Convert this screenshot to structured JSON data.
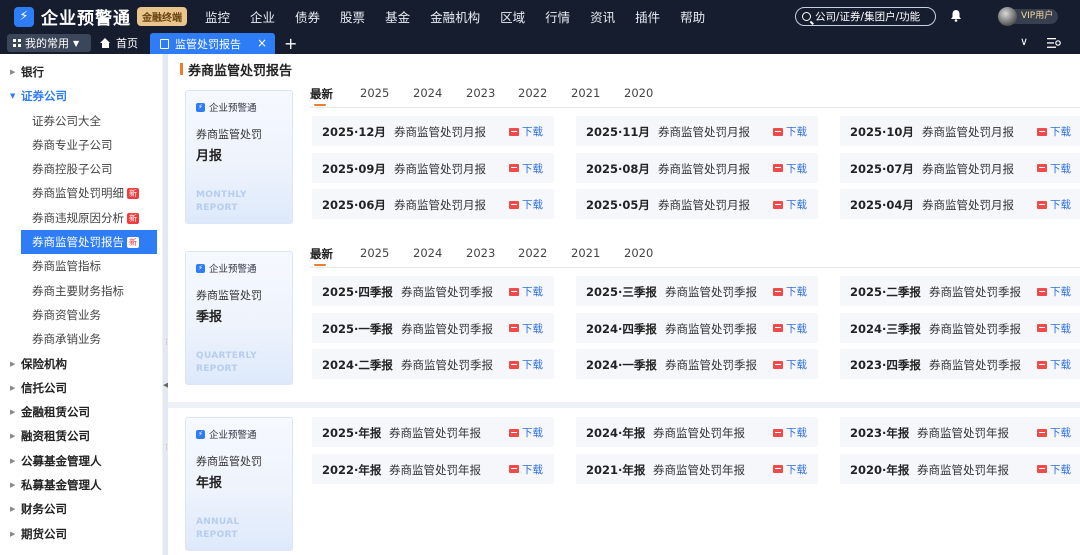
{
  "app": {
    "logo_icon": "lightning-icon",
    "logo_text": "企业预警通",
    "badge": "金融终端",
    "nav": [
      "监控",
      "企业",
      "债券",
      "股票",
      "基金",
      "金融机构",
      "区域",
      "行情",
      "资讯",
      "插件",
      "帮助"
    ],
    "search_placeholder": "公司/证券/集团户/功能",
    "vip_label": "VIP用户"
  },
  "tabbar": {
    "mine_label": "我的常用",
    "home_label": "首页",
    "active_tab": "监管处罚报告",
    "close": "×",
    "add": "+"
  },
  "sidebar": {
    "items": [
      {
        "label": "银行",
        "level": 1,
        "open": false
      },
      {
        "label": "证券公司",
        "level": 1,
        "open": true
      },
      {
        "label": "证券公司大全",
        "level": 2
      },
      {
        "label": "券商专业子公司",
        "level": 2
      },
      {
        "label": "券商控股子公司",
        "level": 2
      },
      {
        "label": "券商监管处罚明细",
        "level": 2,
        "badge": "新"
      },
      {
        "label": "券商违规原因分析",
        "level": 2,
        "badge": "新"
      },
      {
        "label": "券商监管处罚报告",
        "level": 2,
        "badge": "新",
        "active": true
      },
      {
        "label": "券商监管指标",
        "level": 2
      },
      {
        "label": "券商主要财务指标",
        "level": 2
      },
      {
        "label": "券商资管业务",
        "level": 2
      },
      {
        "label": "券商承销业务",
        "level": 2
      },
      {
        "label": "保险机构",
        "level": 1,
        "open": false
      },
      {
        "label": "信托公司",
        "level": 1,
        "open": false
      },
      {
        "label": "金融租赁公司",
        "level": 1,
        "open": false
      },
      {
        "label": "融资租赁公司",
        "level": 1,
        "open": false
      },
      {
        "label": "公募基金管理人",
        "level": 1,
        "open": false
      },
      {
        "label": "私募基金管理人",
        "level": 1,
        "open": false
      },
      {
        "label": "财务公司",
        "level": 1,
        "open": false
      },
      {
        "label": "期货公司",
        "level": 1,
        "open": false
      }
    ]
  },
  "page": {
    "title": "券商监管处罚报告",
    "download_label": "下载",
    "year_tabs": [
      "最新",
      "2025",
      "2024",
      "2023",
      "2022",
      "2021",
      "2020"
    ]
  },
  "sections": [
    {
      "card": {
        "brand": "企业预警通",
        "line1": "券商监管处罚",
        "line2": "月报",
        "en": "MONTHLY REPORT"
      },
      "tabs": true,
      "reports": [
        {
          "period": "2025·12月",
          "name": "券商监管处罚月报"
        },
        {
          "period": "2025·11月",
          "name": "券商监管处罚月报"
        },
        {
          "period": "2025·10月",
          "name": "券商监管处罚月报"
        },
        {
          "period": "2025·09月",
          "name": "券商监管处罚月报"
        },
        {
          "period": "2025·08月",
          "name": "券商监管处罚月报"
        },
        {
          "period": "2025·07月",
          "name": "券商监管处罚月报"
        },
        {
          "period": "2025·06月",
          "name": "券商监管处罚月报"
        },
        {
          "period": "2025·05月",
          "name": "券商监管处罚月报"
        },
        {
          "period": "2025·04月",
          "name": "券商监管处罚月报"
        }
      ]
    },
    {
      "card": {
        "brand": "企业预警通",
        "line1": "券商监管处罚",
        "line2": "季报",
        "en": "QUARTERLY REPORT"
      },
      "tabs": true,
      "reports": [
        {
          "period": "2025·四季报",
          "name": "券商监管处罚季报"
        },
        {
          "period": "2025·三季报",
          "name": "券商监管处罚季报"
        },
        {
          "period": "2025·二季报",
          "name": "券商监管处罚季报"
        },
        {
          "period": "2025·一季报",
          "name": "券商监管处罚季报"
        },
        {
          "period": "2024·四季报",
          "name": "券商监管处罚季报"
        },
        {
          "period": "2024·三季报",
          "name": "券商监管处罚季报"
        },
        {
          "period": "2024·二季报",
          "name": "券商监管处罚季报"
        },
        {
          "period": "2024·一季报",
          "name": "券商监管处罚季报"
        },
        {
          "period": "2023·四季报",
          "name": "券商监管处罚季报"
        }
      ]
    },
    {
      "card": {
        "brand": "企业预警通",
        "line1": "券商监管处罚",
        "line2": "年报",
        "en": "ANNUAL REPORT"
      },
      "tabs": false,
      "reports": [
        {
          "period": "2025·年报",
          "name": "券商监管处罚年报"
        },
        {
          "period": "2024·年报",
          "name": "券商监管处罚年报"
        },
        {
          "period": "2023·年报",
          "name": "券商监管处罚年报"
        },
        {
          "period": "2022·年报",
          "name": "券商监管处罚年报"
        },
        {
          "period": "2021·年报",
          "name": "券商监管处罚年报"
        },
        {
          "period": "2020·年报",
          "name": "券商监管处罚年报"
        }
      ]
    }
  ]
}
